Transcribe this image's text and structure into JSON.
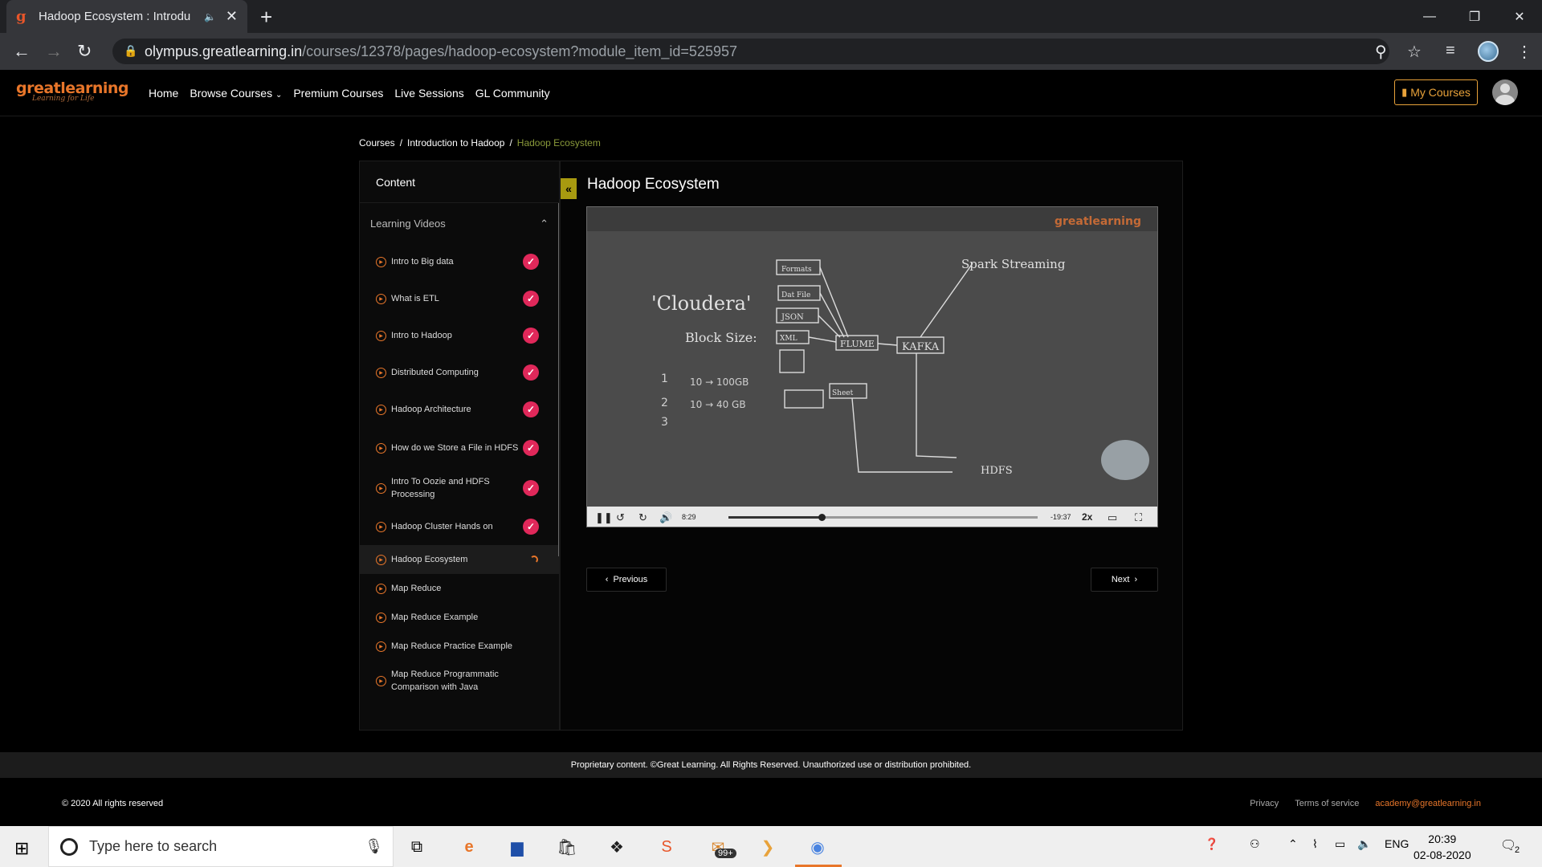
{
  "browser": {
    "tab_title": "Hadoop Ecosystem : Introdu",
    "url_host": "olympus.greatlearning.in",
    "url_path": "/courses/12378/pages/hadoop-ecosystem?module_item_id=525957"
  },
  "site": {
    "logo_main": "greatlearning",
    "logo_tag": "Learning for Life",
    "nav": [
      "Home",
      "Browse Courses",
      "Premium Courses",
      "Live Sessions",
      "GL Community"
    ],
    "my_courses": "My Courses"
  },
  "breadcrumb": [
    "Courses",
    "Introduction to Hadoop",
    "Hadoop Ecosystem"
  ],
  "sidebar": {
    "header": "Content",
    "section": "Learning Videos",
    "items": [
      {
        "label": "Intro to Big data",
        "status": "done"
      },
      {
        "label": "What is ETL",
        "status": "done"
      },
      {
        "label": "Intro to Hadoop",
        "status": "done"
      },
      {
        "label": "Distributed Computing",
        "status": "done"
      },
      {
        "label": "Hadoop Architecture",
        "status": "done"
      },
      {
        "label": "How do we Store a File in HDFS",
        "status": "done"
      },
      {
        "label": "Intro To Oozie and HDFS Processing",
        "status": "done"
      },
      {
        "label": "Hadoop Cluster Hands on",
        "status": "done"
      },
      {
        "label": "Hadoop Ecosystem",
        "status": "active"
      },
      {
        "label": "Map Reduce",
        "status": "none"
      },
      {
        "label": "Map Reduce Example",
        "status": "none"
      },
      {
        "label": "Map Reduce Practice Example",
        "status": "none"
      },
      {
        "label": "Map Reduce Programmatic Comparison with Java",
        "status": "none"
      }
    ]
  },
  "main": {
    "title": "Hadoop Ecosystem",
    "player": {
      "elapsed": "8:29",
      "remaining": "-19:37",
      "speed": "2x",
      "progress": 0.3,
      "watermark": "greatlearning"
    },
    "prev": "Previous",
    "next": "Next"
  },
  "footer": {
    "notice": "Proprietary content. ©Great Learning. All Rights Reserved. Unauthorized use or distribution prohibited.",
    "copyright": "© 2020 All rights reserved",
    "privacy": "Privacy",
    "terms": "Terms of service",
    "email": "academy@greatlearning.in"
  },
  "taskbar": {
    "search_placeholder": "Type here to search",
    "lang": "ENG",
    "time": "20:39",
    "date": "02-08-2020",
    "notif_count": "2",
    "badge": "99+"
  }
}
